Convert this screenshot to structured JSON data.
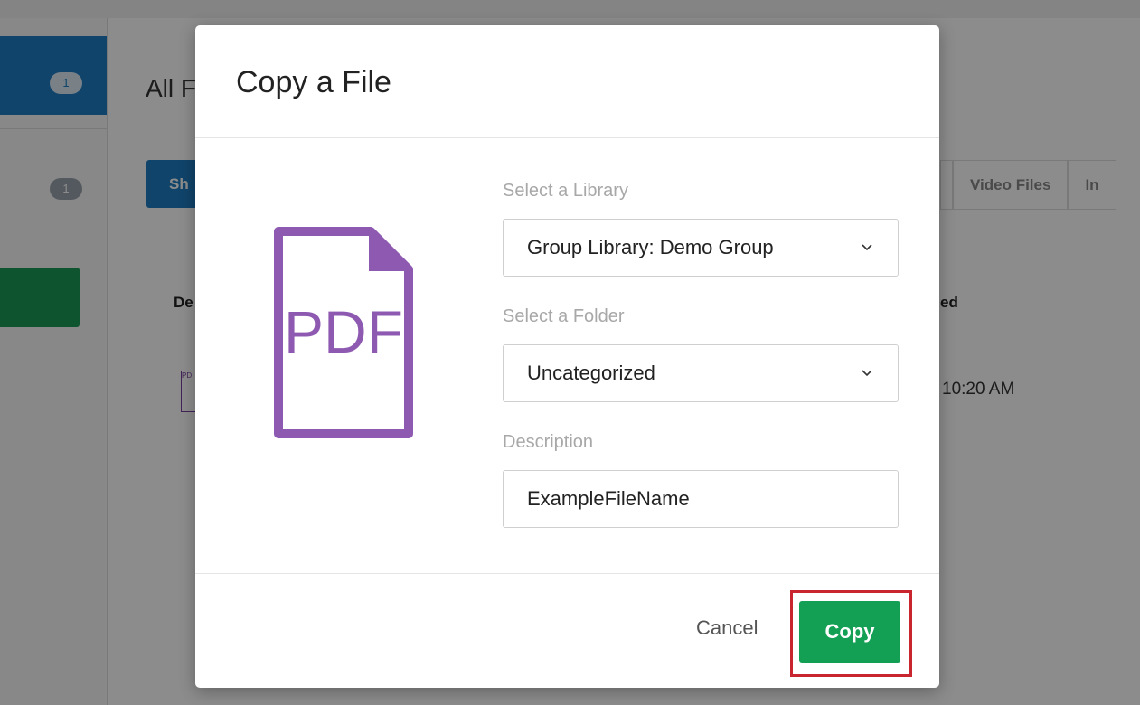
{
  "background": {
    "nav_badge_1": "1",
    "nav_badge_2": "1",
    "page_title": "All F",
    "active_tab": "Sh",
    "right_tabs": [
      "",
      "Video Files",
      "In"
    ],
    "column_left": "De",
    "column_right": "ed",
    "row_time": "10:20 AM",
    "row_file_icon_label": "PD"
  },
  "modal": {
    "title": "Copy a File",
    "file_icon_label": "PDF",
    "library": {
      "label": "Select a Library",
      "value": "Group Library: Demo Group"
    },
    "folder": {
      "label": "Select a Folder",
      "value": "Uncategorized"
    },
    "description": {
      "label": "Description",
      "value": "ExampleFileName"
    },
    "cancel_label": "Cancel",
    "copy_label": "Copy"
  },
  "colors": {
    "primary_blue": "#1e7dc2",
    "green": "#13a055",
    "pdf_purple": "#8e59b0",
    "highlight_red": "#c9252f"
  }
}
